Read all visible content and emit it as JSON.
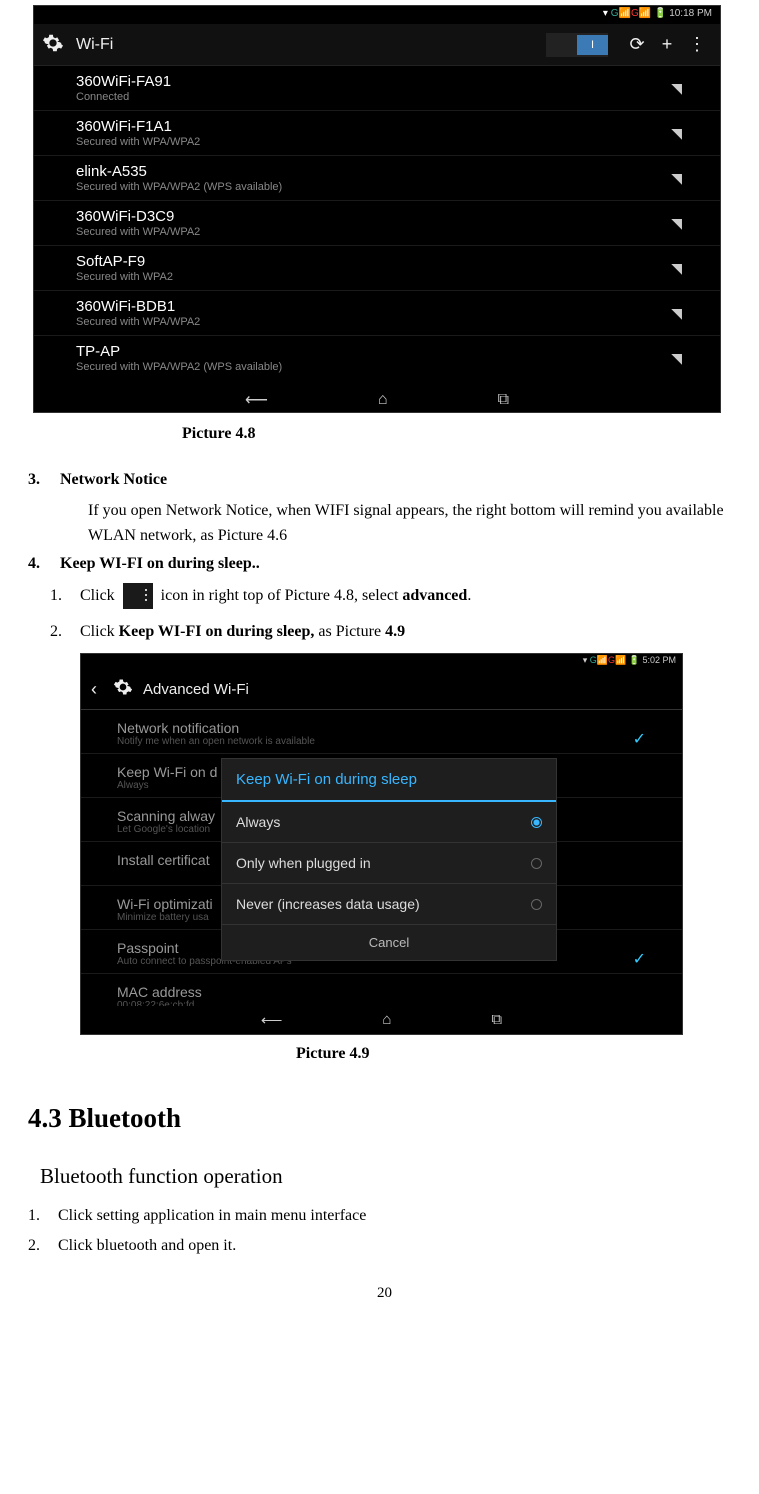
{
  "screenshot1": {
    "status_time": "10:18 PM",
    "status_signals": "▾ G📶 G📶 🔋",
    "title": "Wi-Fi",
    "toggle_on": "I",
    "networks": [
      {
        "name": "360WiFi-FA91",
        "sub": "Connected"
      },
      {
        "name": "360WiFi-F1A1",
        "sub": "Secured with WPA/WPA2"
      },
      {
        "name": "elink-A535",
        "sub": "Secured with WPA/WPA2 (WPS available)"
      },
      {
        "name": "360WiFi-D3C9",
        "sub": "Secured with WPA/WPA2"
      },
      {
        "name": "SoftAP-F9",
        "sub": "Secured with WPA2"
      },
      {
        "name": "360WiFi-BDB1",
        "sub": "Secured with WPA/WPA2"
      },
      {
        "name": "TP-AP",
        "sub": "Secured with WPA/WPA2 (WPS available)"
      }
    ]
  },
  "caption1": "Picture 4.8",
  "item3": {
    "num": "3.",
    "label": "Network Notice"
  },
  "item3_body": "If you open Network Notice, when WIFI signal appears, the right bottom will remind you available WLAN network, as Picture 4.6",
  "item4": {
    "num": "4.",
    "label": "Keep WI-FI on during sleep.."
  },
  "sub1": {
    "num": "1.",
    "pre": "Click ",
    "post": " icon in right top of Picture 4.8, select ",
    "bold": "advanced",
    "end": "."
  },
  "sub2": {
    "num": "2.",
    "pre": "Click ",
    "bold1": "Keep WI-FI on during sleep,",
    "post": " as Picture ",
    "bold2": "4.9"
  },
  "screenshot2": {
    "status_time": "5:02 PM",
    "title": "Advanced Wi-Fi",
    "rows": [
      {
        "title": "Network notification",
        "sub": "Notify me when an open network is available",
        "check": true
      },
      {
        "title": "Keep Wi-Fi on d",
        "sub": "Always"
      },
      {
        "title": "Scanning alway",
        "sub": "Let Google's location"
      },
      {
        "title": "Install certificat",
        "sub": ""
      },
      {
        "title": "Wi-Fi optimizati",
        "sub": "Minimize battery usa"
      },
      {
        "title": "Passpoint",
        "sub": "Auto connect to passpoint-enabled APs",
        "check": true
      },
      {
        "title": "MAC address",
        "sub": "00:08:22:6e:cb:fd"
      }
    ],
    "dialog": {
      "title": "Keep Wi-Fi on during sleep",
      "opts": [
        "Always",
        "Only when plugged in",
        "Never (increases data usage)"
      ],
      "selected": 0,
      "cancel": "Cancel"
    }
  },
  "caption2": "Picture 4.9",
  "section": "4.3   Bluetooth",
  "subsection": "Bluetooth function operation",
  "bt1": {
    "num": "1.",
    "text": "Click setting application in main menu interface"
  },
  "bt2": {
    "num": "2.",
    "text": "Click bluetooth and open it."
  },
  "pagenum": "20"
}
